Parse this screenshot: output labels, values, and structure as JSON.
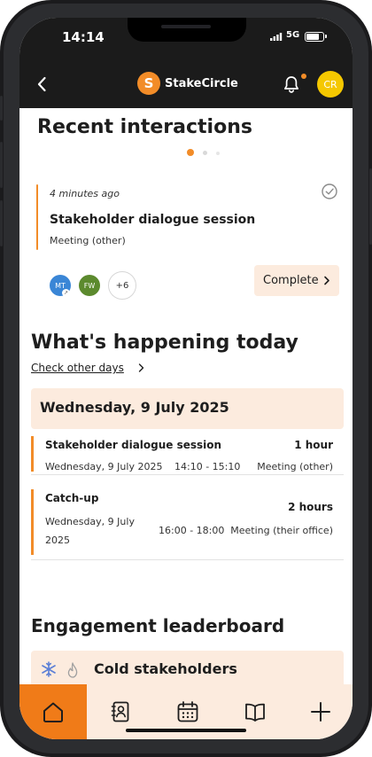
{
  "status_bar": {
    "time": "14:14",
    "network": "5G",
    "battery_level": 0.85
  },
  "header": {
    "brand_name": "StakeCircle",
    "logo_letter": "S",
    "avatar_initials": "CR"
  },
  "recent": {
    "title": "Recent interactions",
    "carousel": {
      "total": 3,
      "active": 1
    },
    "card": {
      "time": "4 minutes ago",
      "title": "Stakeholder dialogue session",
      "type": "Meeting (other)",
      "participants": [
        {
          "initials": "MT",
          "color": "#3a86d6"
        },
        {
          "initials": "FW",
          "color": "#5c8a2e"
        }
      ],
      "more_count": "+6",
      "complete_label": "Complete"
    }
  },
  "today": {
    "title": "What's happening today",
    "check_other_days": "Check other days",
    "date_heading": "Wednesday, 9 July 2025",
    "events": [
      {
        "title": "Stakeholder dialogue session",
        "duration": "1 hour",
        "date": "Wednesday, 9 July 2025",
        "time": "14:10 - 15:10",
        "type": "Meeting (other)"
      },
      {
        "title": "Catch-up",
        "duration": "2 hours",
        "date_line1": "Wednesday, 9 July",
        "date_line2": "2025",
        "time": "16:00 - 18:00",
        "type": "Meeting (their office)"
      }
    ]
  },
  "leaderboard": {
    "title": "Engagement leaderboard",
    "cold_label": "Cold stakeholders"
  },
  "nav": {
    "items": [
      "home",
      "contacts",
      "calendar",
      "library",
      "add"
    ],
    "active": "home"
  },
  "colors": {
    "accent": "#f28c28",
    "nav_active": "#f07b18",
    "soft_bg": "#fcebde",
    "header_bg": "#1b1b1b",
    "avatar": "#f5c800"
  }
}
